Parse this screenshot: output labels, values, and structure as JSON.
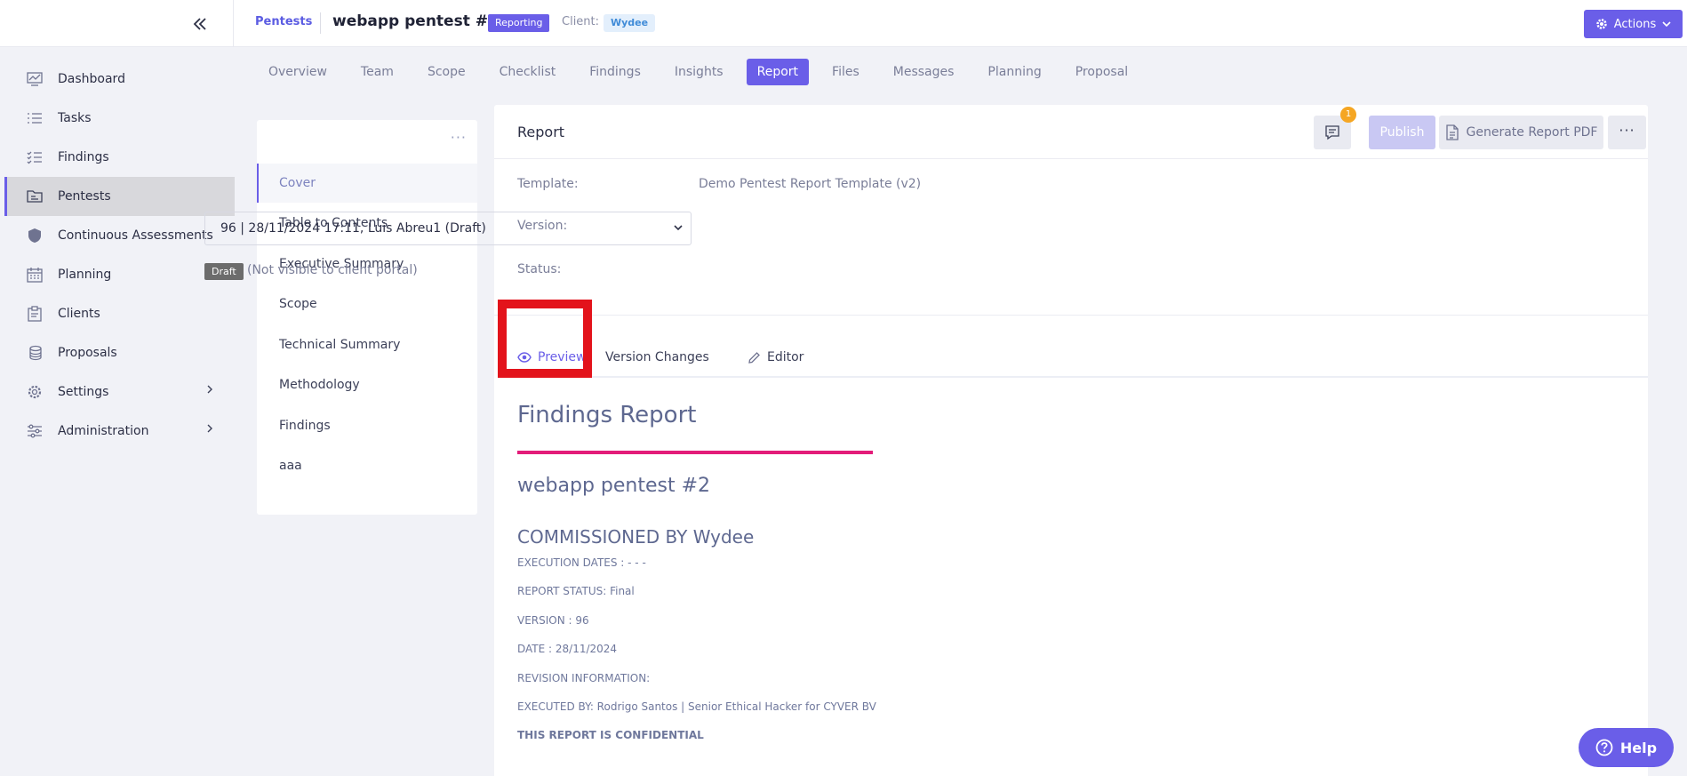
{
  "header": {
    "breadcrumb": "Pentests",
    "title": "webapp pentest #2",
    "status_badge": "Reporting",
    "client_label": "Client:",
    "client_name": "Wydee",
    "actions_label": "Actions"
  },
  "sidebar": {
    "items": [
      {
        "label": "Dashboard",
        "icon": "chart-icon"
      },
      {
        "label": "Tasks",
        "icon": "list-icon"
      },
      {
        "label": "Findings",
        "icon": "checklist-icon"
      },
      {
        "label": "Pentests",
        "icon": "folder-icon"
      },
      {
        "label": "Continuous Assessments",
        "icon": "shield-icon"
      },
      {
        "label": "Planning",
        "icon": "calendar-icon"
      },
      {
        "label": "Clients",
        "icon": "clipboard-icon"
      },
      {
        "label": "Proposals",
        "icon": "coins-icon"
      },
      {
        "label": "Settings",
        "icon": "gear-icon"
      },
      {
        "label": "Administration",
        "icon": "sliders-icon"
      }
    ],
    "active": "Pentests"
  },
  "tabs": [
    "Overview",
    "Team",
    "Scope",
    "Checklist",
    "Findings",
    "Insights",
    "Report",
    "Files",
    "Messages",
    "Planning",
    "Proposal"
  ],
  "active_tab": "Report",
  "sections": {
    "more": "···",
    "items": [
      "Cover",
      "Table to Contents",
      "Executive Summary",
      "Scope",
      "Technical Summary",
      "Methodology",
      "Findings",
      "aaa"
    ],
    "active": "Cover"
  },
  "report": {
    "title": "Report",
    "comment_count": "1",
    "publish_label": "Publish",
    "pdf_label": "Generate Report PDF",
    "more": "···",
    "template_label": "Template:",
    "template_value": "Demo Pentest Report Template (v2)",
    "version_label": "Version:",
    "version_value": "96 | 28/11/2024 17:11, Luis Abreu1 (Draft)",
    "status_label": "Status:",
    "status_badge": "Draft",
    "status_note": "(Not visible to client portal)",
    "preview_tabs": [
      "Preview",
      "Version Changes",
      "Editor"
    ],
    "active_preview_tab": "Preview"
  },
  "preview": {
    "heading": "Findings Report",
    "subheading": "webapp pentest #2",
    "commissioned": "COMMISSIONED BY Wydee",
    "lines": [
      "EXECUTION DATES : - - -",
      "REPORT STATUS: Final",
      "VERSION : 96",
      "DATE : 28/11/2024",
      "REVISION INFORMATION:",
      "EXECUTED BY: Rodrigo Santos | Senior Ethical Hacker for CYVER BV"
    ],
    "confidential": "THIS REPORT IS CONFIDENTIAL"
  },
  "help_label": "Help",
  "colors": {
    "accent": "#6a5ee8",
    "highlight": "#e3131b",
    "report_bar": "#e31c79"
  }
}
